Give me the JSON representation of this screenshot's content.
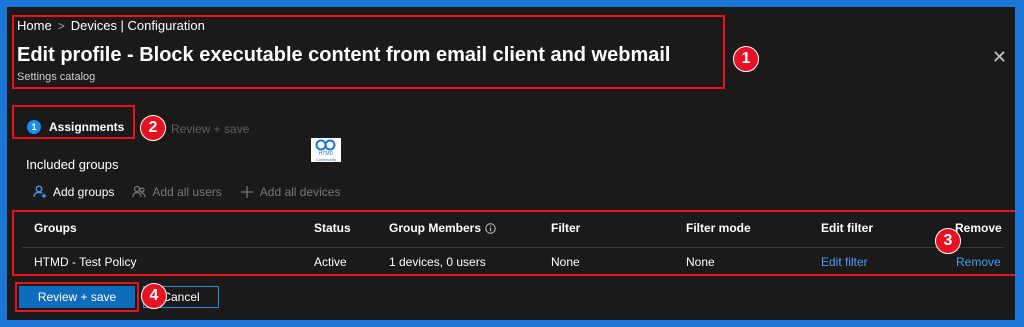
{
  "breadcrumb": {
    "home": "Home",
    "sep": ">",
    "current": "Devices | Configuration"
  },
  "header": {
    "title": "Edit profile - Block executable content from email client and webmail",
    "subtitle": "Settings catalog",
    "close_glyph": "✕"
  },
  "wizard": {
    "step_number": "1",
    "assignments_label": "Assignments",
    "review_label": "Review + save"
  },
  "logo": {
    "text": "HTMD",
    "subtext": "Community"
  },
  "included_groups": {
    "label": "Included groups",
    "commands": [
      {
        "label": "Add groups",
        "icon": "add-group-icon",
        "enabled": true
      },
      {
        "label": "Add all users",
        "icon": "all-users-icon",
        "enabled": false
      },
      {
        "label": "Add all devices",
        "icon": "plus-icon",
        "enabled": false
      }
    ]
  },
  "table": {
    "headers": {
      "groups": "Groups",
      "status": "Status",
      "members": "Group Members",
      "filter": "Filter",
      "filter_mode": "Filter mode",
      "edit_filter": "Edit filter",
      "remove": "Remove"
    },
    "rows": [
      {
        "group": "HTMD - Test Policy",
        "status": "Active",
        "members": "1 devices, 0 users",
        "filter": "None",
        "filter_mode": "None",
        "edit_filter": "Edit filter",
        "remove": "Remove"
      }
    ]
  },
  "buttons": {
    "review_save": "Review + save",
    "cancel": "Cancel"
  },
  "annotations": [
    "1",
    "2",
    "3",
    "4"
  ],
  "colors": {
    "annotation_red": "#e81123",
    "accent": "#0f6cbd",
    "link": "#479ef5",
    "background": "#1b1a19",
    "frame": "#1b76d8"
  }
}
